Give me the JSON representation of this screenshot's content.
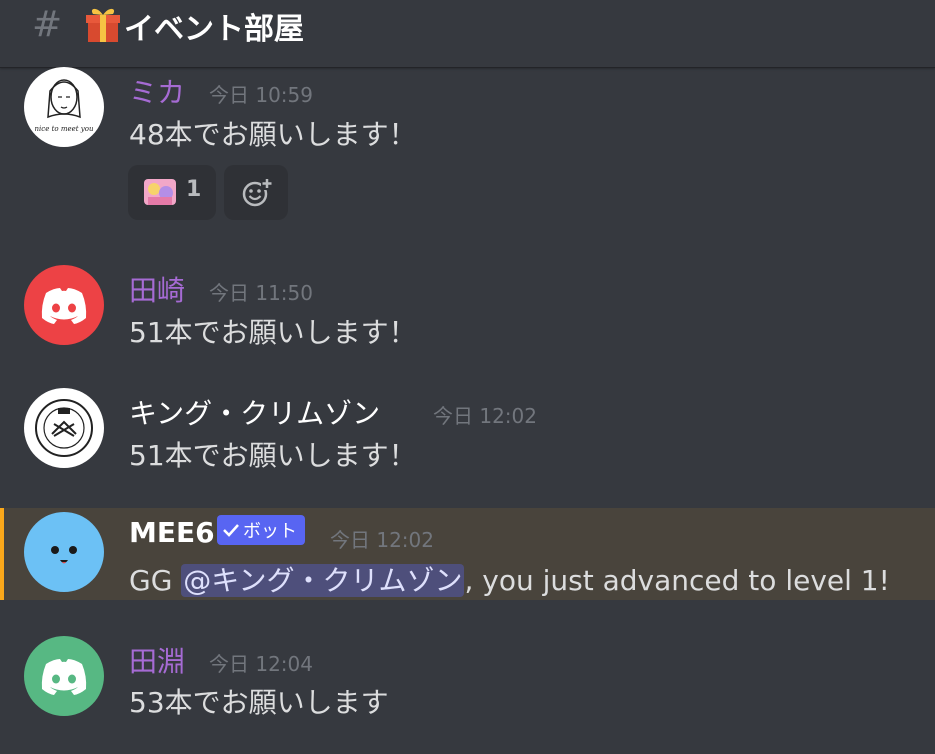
{
  "header": {
    "hash": "#",
    "channel_name": "イベント部屋",
    "icon": "gift-icon"
  },
  "colors": {
    "background": "#36393f",
    "username_purple": "#a66bd4",
    "timestamp": "#72767d",
    "bot_tag": "#5865f2",
    "highlight_bg": "#49443c",
    "highlight_bar": "#faa81a"
  },
  "messages": [
    {
      "username": "ミカ",
      "timestamp": "今日 10:59",
      "text": "48本でお願いします！",
      "avatar_text": "nice to meet you",
      "reaction": {
        "emoji": "image-emoji",
        "count": "1"
      }
    },
    {
      "username": "田崎",
      "timestamp": "今日 11:50",
      "text": "51本でお願いします！",
      "avatar": "discord-red"
    },
    {
      "username": "キング・クリムゾン",
      "timestamp": "今日 12:02",
      "text": "51本でお願いします！",
      "avatar": "stamp-logo"
    },
    {
      "username": "MEE6",
      "bot_tag": "ボット",
      "timestamp": "今日 12:02",
      "text_before": "GG ",
      "mention": "@キング・クリムゾン",
      "text_after": ", you just advanced to level 1!",
      "avatar": "mee6-face"
    },
    {
      "username": "田淵",
      "timestamp": "今日 12:04",
      "text": "53本でお願いします",
      "avatar": "discord-green"
    }
  ]
}
